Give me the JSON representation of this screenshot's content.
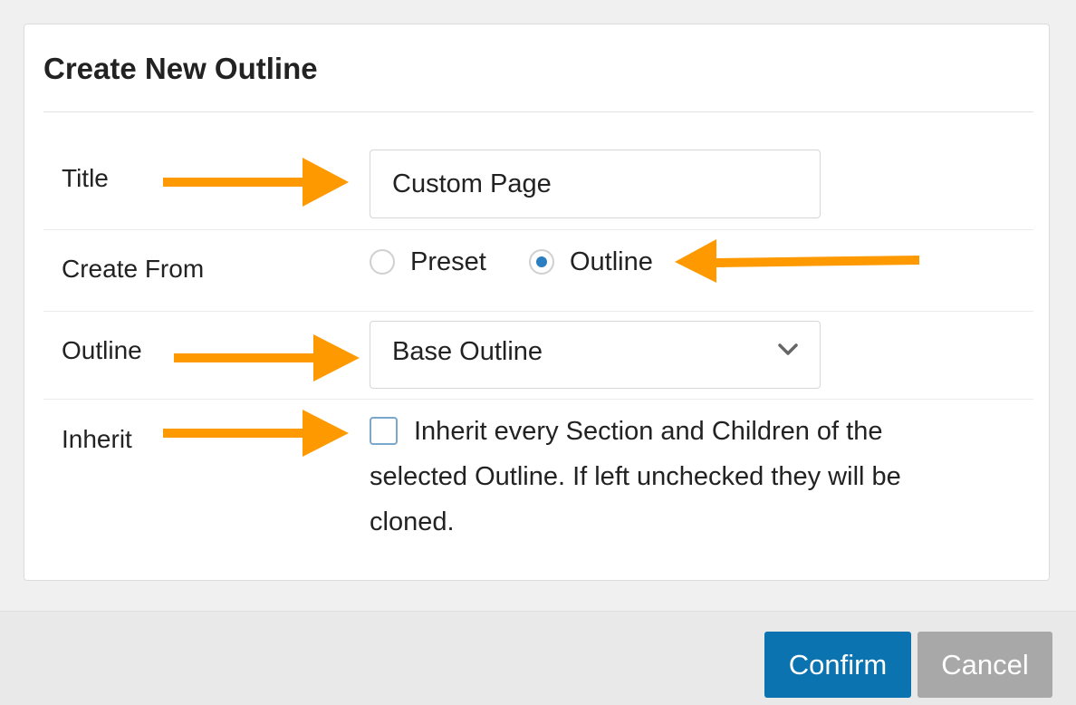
{
  "dialog": {
    "title": "Create New Outline"
  },
  "form": {
    "title_label": "Title",
    "title_value": "Custom Page",
    "create_from_label": "Create From",
    "create_from_options": [
      "Preset",
      "Outline"
    ],
    "create_from_selected": "Outline",
    "outline_label": "Outline",
    "outline_value": "Base Outline",
    "inherit_label": "Inherit",
    "inherit_checked": false,
    "inherit_text": "Inherit every Section and Children of the selected Outline. If left unchecked they will be cloned."
  },
  "footer": {
    "confirm_label": "Confirm",
    "cancel_label": "Cancel"
  },
  "colors": {
    "annotation_arrow": "#ff9900",
    "confirm_button": "#0b73b0",
    "cancel_button": "#a8a8a8",
    "radio_selected": "#2b7fc1"
  },
  "icons": {
    "select_chevron": "chevron-down-icon",
    "annotation": "arrow-icon"
  }
}
